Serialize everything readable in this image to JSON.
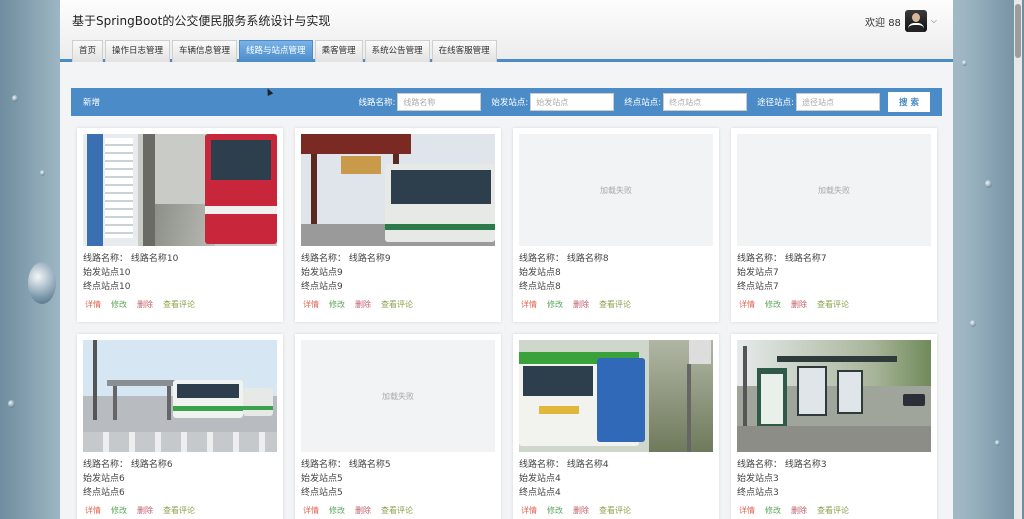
{
  "app": {
    "title": "基于SpringBoot的公交便民服务系统设计与实现"
  },
  "user": {
    "welcome": "欢迎 88"
  },
  "tabs": [
    {
      "label": "首页"
    },
    {
      "label": "操作日志管理"
    },
    {
      "label": "车辆信息管理"
    },
    {
      "label": "线路与站点管理"
    },
    {
      "label": "乘客管理"
    },
    {
      "label": "系统公告管理"
    },
    {
      "label": "在线客服管理"
    }
  ],
  "toolbar": {
    "add_label": "新增",
    "search_label": "搜 索",
    "filters": [
      {
        "label": "线路名称:",
        "placeholder": "线路名称"
      },
      {
        "label": "始发站点:",
        "placeholder": "始发站点"
      },
      {
        "label": "终点站点:",
        "placeholder": "终点站点"
      },
      {
        "label": "途径站点:",
        "placeholder": "途径站点"
      }
    ]
  },
  "card_actions": {
    "detail": "详情",
    "edit": "修改",
    "delete": "删除",
    "review": "查看评论"
  },
  "image_fail_text": "加载失败",
  "cards": [
    {
      "route": "线路名称：  线路名称10",
      "start": "始发站点10",
      "end": "终点站点10",
      "image": "bus-roadside"
    },
    {
      "route": "线路名称：  线路名称9",
      "start": "始发站点9",
      "end": "终点站点9",
      "image": "bus-pavilion"
    },
    {
      "route": "线路名称：  线路名称8",
      "start": "始发站点8",
      "end": "终点站点8",
      "image": "fail"
    },
    {
      "route": "线路名称：  线路名称7",
      "start": "始发站点7",
      "end": "终点站点7",
      "image": "fail"
    },
    {
      "route": "线路名称：  线路名称6",
      "start": "始发站点6",
      "end": "终点站点6",
      "image": "bus-station"
    },
    {
      "route": "线路名称：  线路名称5",
      "start": "始发站点5",
      "end": "终点站点5",
      "image": "fail"
    },
    {
      "route": "线路名称：  线路名称4",
      "start": "始发站点4",
      "end": "终点站点4",
      "image": "bus-green"
    },
    {
      "route": "线路名称：  线路名称3",
      "start": "始发站点3",
      "end": "终点站点3",
      "image": "bus-shelter"
    }
  ],
  "colors": {
    "accent": "#4a8bc8",
    "detail": "#e2634f",
    "edit": "#5aa85a",
    "delete": "#c05d6a",
    "review": "#8aa24a"
  }
}
